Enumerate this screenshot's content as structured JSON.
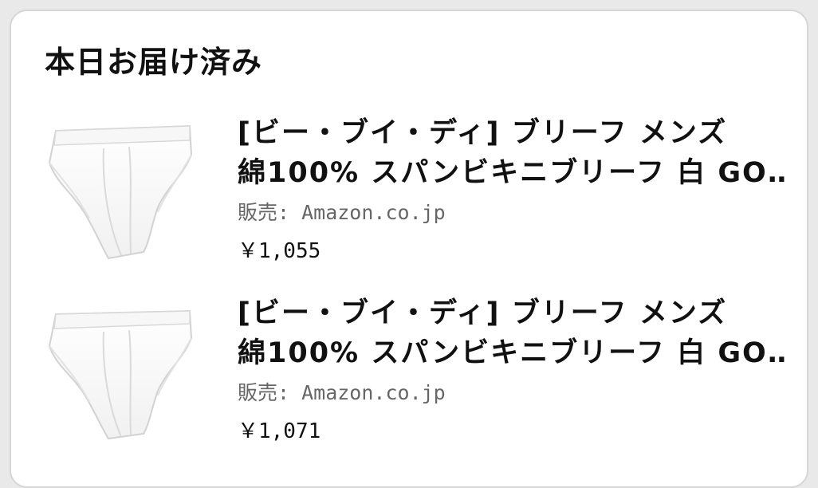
{
  "section": {
    "title": "本日お届け済み"
  },
  "items": [
    {
      "title_line1": "[ビー・ブイ・ディ] ブリーフ メンズ",
      "title_line2": "綿100% スパンビキニブリーフ 白 GO…",
      "seller": "販売: Amazon.co.jp",
      "price": "￥1,055",
      "image": "white-bikini-brief-product-image"
    },
    {
      "title_line1": "[ビー・ブイ・ディ] ブリーフ メンズ",
      "title_line2": "綿100% スパンビキニブリーフ 白 GO…",
      "seller": "販売: Amazon.co.jp",
      "price": "￥1,071",
      "image": "white-bikini-brief-product-image"
    }
  ]
}
